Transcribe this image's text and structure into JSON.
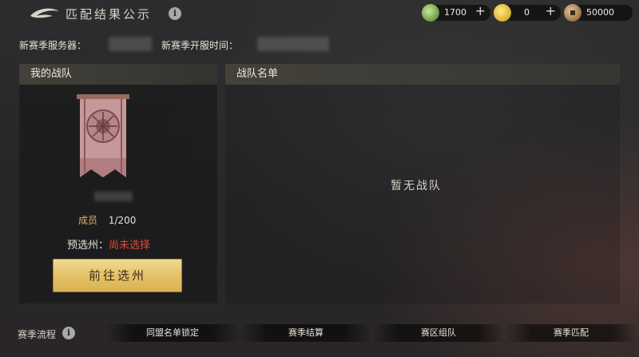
{
  "header": {
    "title": "匹配结果公示",
    "info_icon": "info-icon"
  },
  "resources": [
    {
      "icon": "jade-coin-icon",
      "value": "1700",
      "plus": "+"
    },
    {
      "icon": "gold-ingot-icon",
      "value": "0",
      "plus": "+"
    },
    {
      "icon": "copper-coin-icon",
      "value": "50000"
    }
  ],
  "season": {
    "server_label": "新赛季服务器：",
    "open_time_label": "新赛季开服时间："
  },
  "my_team": {
    "title": "我的战队",
    "members_label": "成员",
    "members_value": "1/200",
    "preselect_label": "预选州：",
    "preselect_value": "尚未选择",
    "go_button": "前往选州"
  },
  "team_list": {
    "title": "战队名单",
    "empty_text": "暂无战队"
  },
  "season_flow": {
    "label": "赛季流程",
    "steps": [
      "同盟名单锁定",
      "赛季结算",
      "赛区组队",
      "赛季匹配"
    ]
  },
  "colors": {
    "accent_gold": "#d9b36a",
    "warning_red": "#e04a3a",
    "button_gold": "#e4c268"
  }
}
